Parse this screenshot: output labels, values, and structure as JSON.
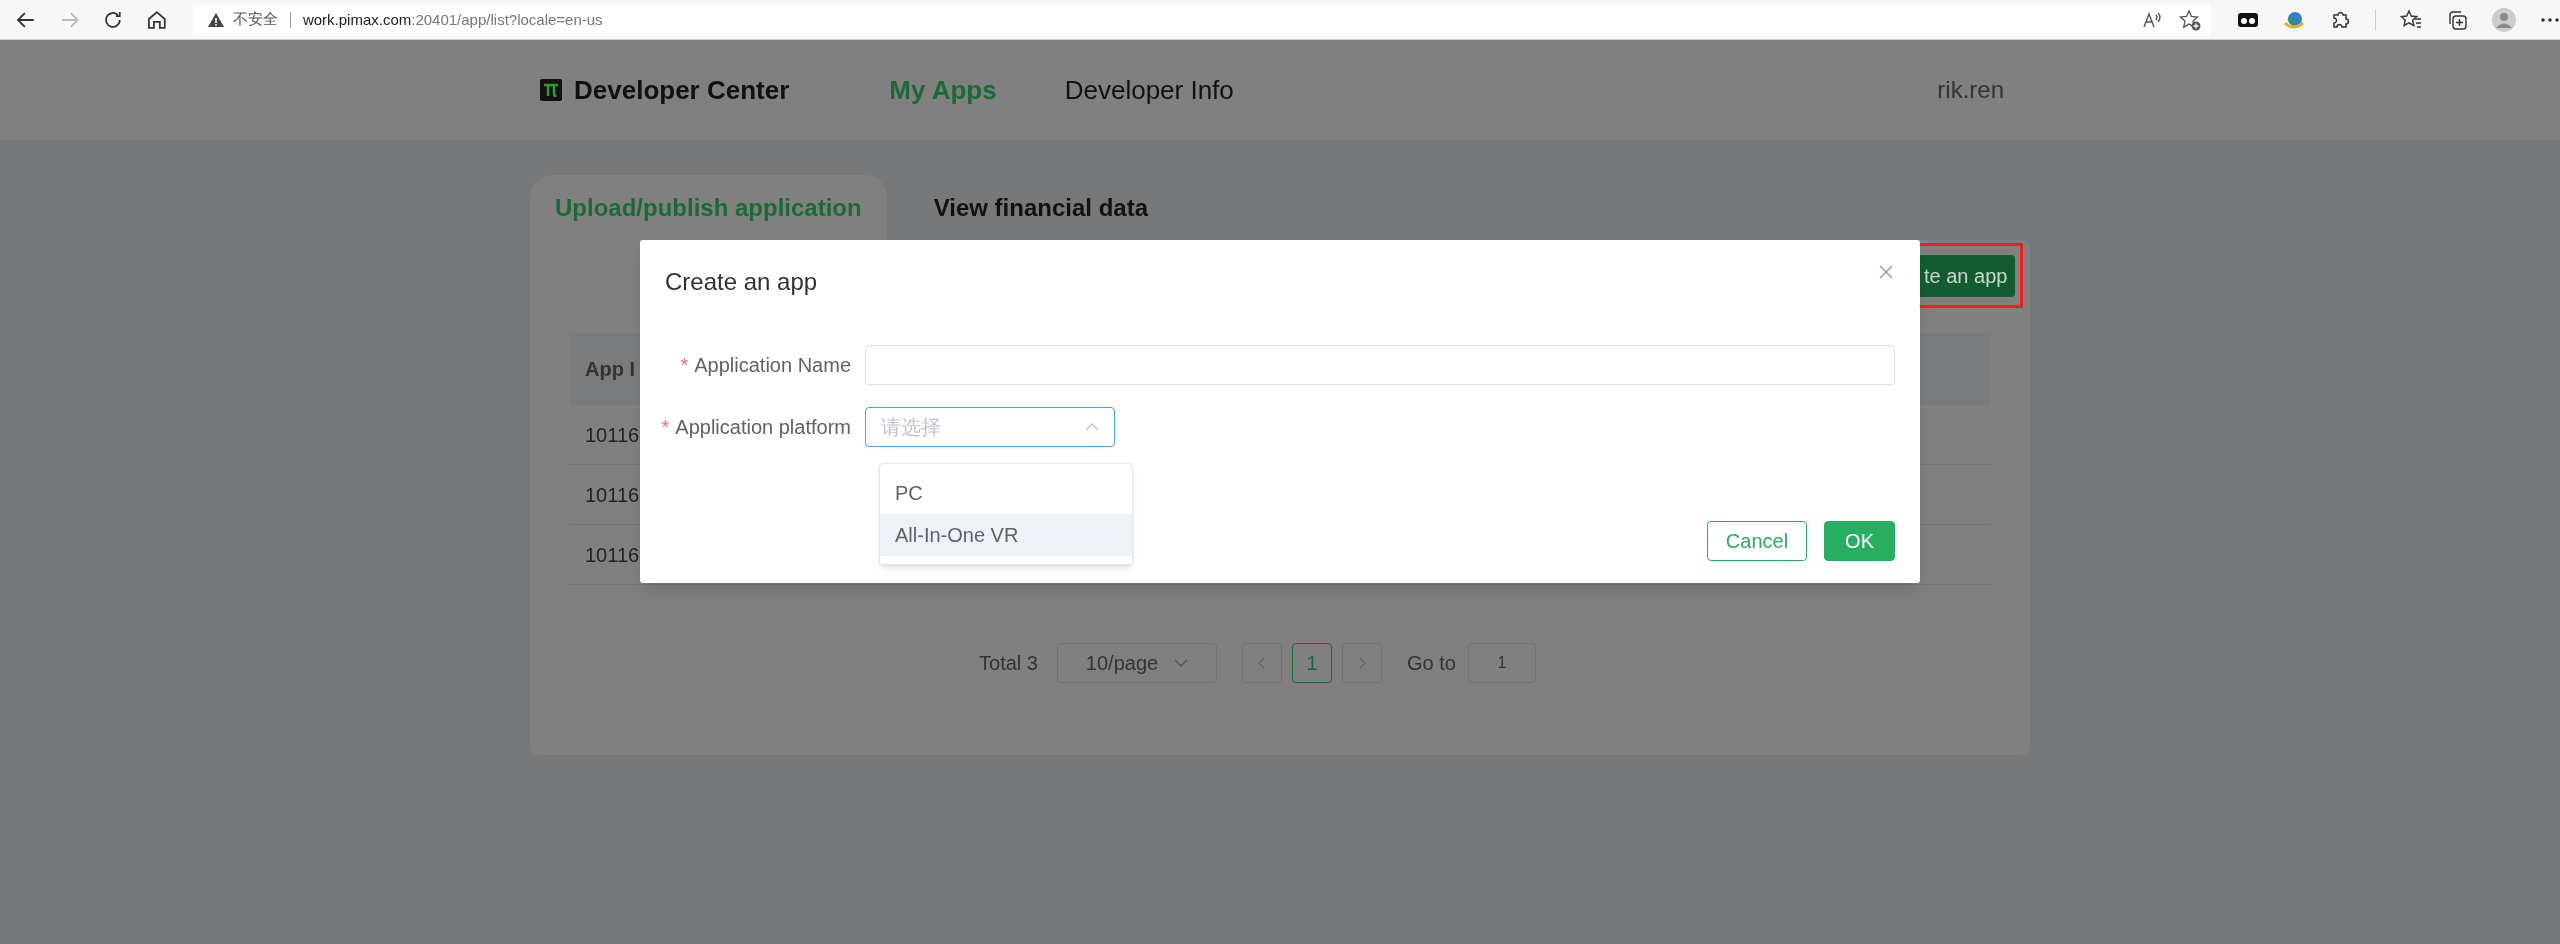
{
  "browser": {
    "security_label": "不安全",
    "url_host": "work.pimax.com",
    "url_path": ":20401/app/list?locale=en-us"
  },
  "header": {
    "brand": "Developer Center",
    "nav": [
      {
        "label": "My Apps",
        "selected": true
      },
      {
        "label": "Developer Info",
        "selected": false
      }
    ],
    "user": "rik.ren"
  },
  "tabs": [
    {
      "label": "Upload/publish application",
      "selected": true
    },
    {
      "label": "View financial data",
      "selected": false
    }
  ],
  "create_button": {
    "label": "te an app",
    "highlighted": true
  },
  "table": {
    "columns": [
      "App I"
    ],
    "rows": [
      [
        "10116"
      ],
      [
        "10116"
      ],
      [
        "10116"
      ]
    ]
  },
  "pagination": {
    "total": "Total 3",
    "page_size": "10/page",
    "pages": [
      {
        "label": "1",
        "selected": true
      }
    ],
    "goto_label": "Go to",
    "goto_value": "1"
  },
  "dialog": {
    "title": "Create an app",
    "fields": [
      {
        "kind": "text",
        "label": "Application Name",
        "required_mark": "*"
      },
      {
        "kind": "select",
        "label": "Application platform",
        "required_mark": "*",
        "placeholder": "请选择",
        "expanded": true
      }
    ],
    "options": [
      {
        "label": "PC",
        "highlighted": false
      },
      {
        "label": "All-In-One VR",
        "highlighted": true
      }
    ],
    "buttons": [
      {
        "kind": "secondary",
        "label": "Cancel"
      },
      {
        "kind": "primary",
        "label": "OK"
      }
    ]
  }
}
